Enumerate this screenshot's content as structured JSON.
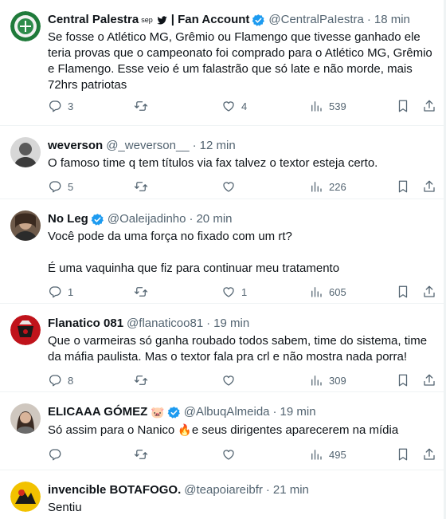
{
  "colors": {
    "accent": "#1d9bf0",
    "muted": "#536471",
    "text": "#0f1419",
    "divider": "#eff3f4"
  },
  "tweets": [
    {
      "name": "Central Palestra",
      "name_suffix": "sep",
      "name_extra": "| Fan Account",
      "handle": "@CentralPaIestra",
      "time": "18 min",
      "verified": true,
      "text": "Se fosse o Atlético MG, Grêmio ou Flamengo que tivesse ganhado ele teria provas que o campeonato foi comprado para o Atlético MG, Grêmio e Flamengo. Esse veio é um falastrão que só late e não morde, mais 72hrs patriotas",
      "replies": "3",
      "retweets": "",
      "likes": "4",
      "views": "539"
    },
    {
      "name": "weverson",
      "handle": "@_weverson__",
      "time": "12 min",
      "text": "O famoso time q tem títulos via fax talvez o textor esteja certo.",
      "replies": "5",
      "retweets": "",
      "likes": "",
      "views": "226"
    },
    {
      "name": "No Leg",
      "handle": "@Oaleijadinho",
      "time": "20 min",
      "verified": true,
      "text1": "Você pode da uma força no fixado com um rt?",
      "text2": "É uma vaquinha que fiz para continuar meu tratamento",
      "replies": "1",
      "retweets": "",
      "likes": "1",
      "views": "605"
    },
    {
      "name": "Flanatico 081",
      "handle": "@flanaticoo81",
      "time": "19 min",
      "text": "Que o varmeiras só ganha roubado todos sabem, time do sistema, time da máfia paulista. Mas o textor fala pra crl e não mostra nada porra!",
      "replies": "8",
      "retweets": "",
      "likes": "",
      "views": "309"
    },
    {
      "name": "ELICAAA GÓMEZ",
      "name_emoji": "🐷",
      "handle": "@AlbuqAlmeida",
      "time": "19 min",
      "verified": true,
      "text_a": "Só assim para o Nanico",
      "text_emoji": "🔥",
      "text_b": "e seus dirigentes aparecerem na mídia",
      "replies": "",
      "retweets": "",
      "likes": "",
      "views": "495"
    },
    {
      "name": "invencible BOTAFOGO.",
      "handle": "@teapoiareibfr",
      "time": "21 min",
      "text": "Sentiu"
    }
  ]
}
